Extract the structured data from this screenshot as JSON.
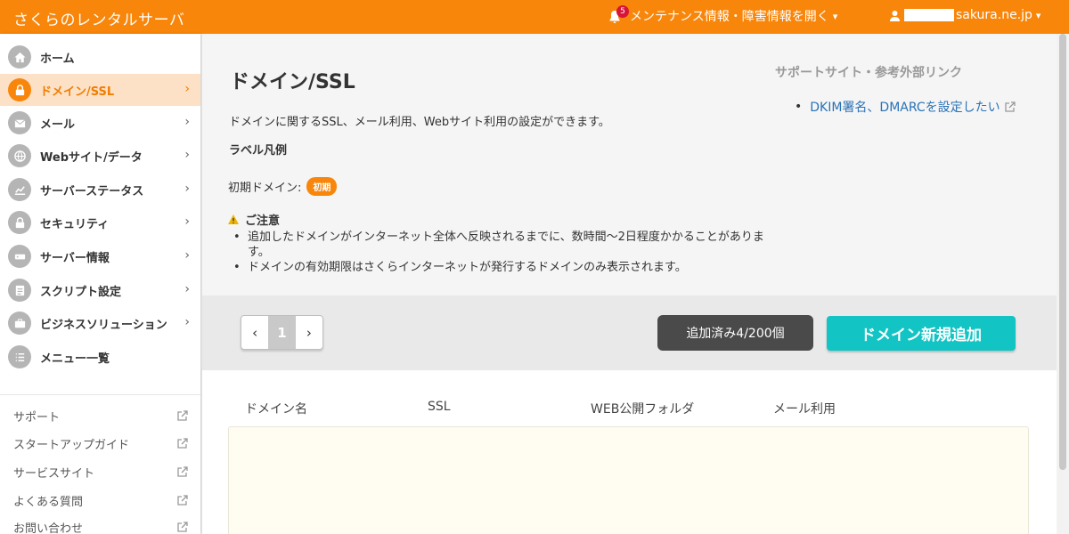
{
  "header": {
    "brand": "さくらのレンタルサーバ",
    "notifications_count": "5",
    "notifications_label": "メンテナンス情報・障害情報を開く",
    "account_suffix": "sakura.ne.jp"
  },
  "sidebar": {
    "items": [
      {
        "label": "ホーム",
        "icon": "home-icon"
      },
      {
        "label": "ドメイン/SSL",
        "icon": "lock-icon"
      },
      {
        "label": "メール",
        "icon": "mail-icon"
      },
      {
        "label": "Webサイト/データ",
        "icon": "globe-icon"
      },
      {
        "label": "サーバーステータス",
        "icon": "chart-icon"
      },
      {
        "label": "セキュリティ",
        "icon": "padlock-icon"
      },
      {
        "label": "サーバー情報",
        "icon": "server-icon"
      },
      {
        "label": "スクリプト設定",
        "icon": "script-icon"
      },
      {
        "label": "ビジネスソリューション",
        "icon": "briefcase-icon"
      },
      {
        "label": "メニュー一覧",
        "icon": "list-icon"
      }
    ],
    "links": [
      {
        "label": "サポート"
      },
      {
        "label": "スタートアップガイド"
      },
      {
        "label": "サービスサイト"
      },
      {
        "label": "よくある質問"
      },
      {
        "label": "お問い合わせ"
      }
    ]
  },
  "main": {
    "title": "ドメイン/SSL",
    "description": "ドメインに関するSSL、メール利用、Webサイト利用の設定ができます。",
    "label_legend": "ラベル凡例",
    "initial_domain_label": "初期ドメイン:",
    "initial_badge": "初期",
    "notice_title": "ご注意",
    "notices": [
      "追加したドメインがインターネット全体へ反映されるまでに、数時間〜2日程度かかることがあります。",
      "ドメインの有効期限はさくらインターネットが発行するドメインのみ表示されます。"
    ],
    "support_title": "サポートサイト・参考外部リンク",
    "support_link": "DKIM署名、DMARCを設定したい"
  },
  "toolbar": {
    "page_prev": "‹",
    "page_current": "1",
    "page_next": "›",
    "added_count": "追加済み4/200個",
    "add_button": "ドメイン新規追加"
  },
  "table": {
    "columns": [
      "ドメイン名",
      "SSL",
      "WEB公開フォルダ",
      "メール利用"
    ]
  },
  "colors": {
    "accent": "#f8860b",
    "primary_button": "#13c4c4",
    "link": "#2a72b5"
  }
}
